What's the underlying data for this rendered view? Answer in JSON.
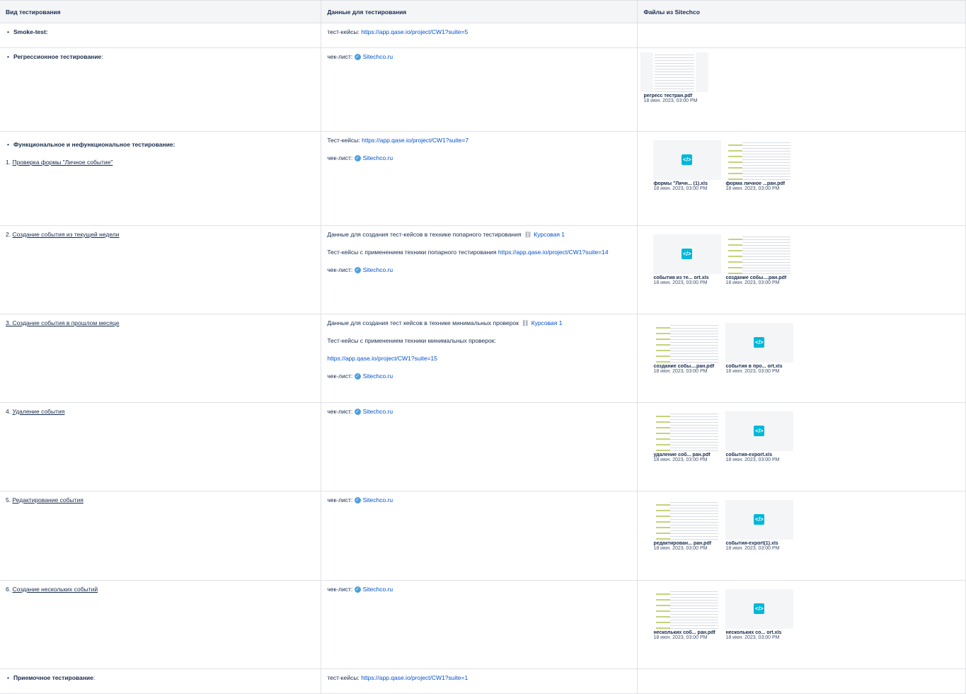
{
  "headers": {
    "col1": "Вид тестирования",
    "col2": "Данные для тестирования",
    "col3": "Файлы из Sitechco"
  },
  "common": {
    "checklist_prefix": "чек-лист:",
    "sitechco": "Sitechco.ru",
    "date": "18 июн. 2023, 03:00 PM",
    "kursovaya": "Курсовая 1"
  },
  "smoke": {
    "label": "Smoke-test:",
    "prefix": "тест-кейсы:",
    "link": "https://app.qase.io/project/CW1?suite=5"
  },
  "regression": {
    "label": "Регрессионное тестирование",
    "label_suffix": ":",
    "file": "регресс тестран.pdf"
  },
  "functional": {
    "label": "Функциональное и нефункциональное тестирование:",
    "item1_num": "1.",
    "item1": "Проверка формы \"Личное событие\"",
    "tc_prefix": "Тест-кейсы:",
    "tc_link": "https://app.qase.io/project/CW1?suite=7",
    "file1": "формы \"Личн... (1).xls",
    "file2": "форма личное ...ран.pdf"
  },
  "week": {
    "num": "2.",
    "label": "Создание события из текущей недели",
    "data_text": "Данные для создания тест-кейсов в технике попарного тестирования",
    "tc_text": "Тест-кейсы с применением техники попарного тестирования",
    "tc_link": "https://app.qase.io/project/CW1?suite=14",
    "file1": "события из те... ort.xls",
    "file2": "создание собы....ран.pdf"
  },
  "month": {
    "num": "3.",
    "label": "Создание события в прошлом месяце",
    "data_text": "Данные для создания тест кейсов в технике минимальных проверок",
    "tc_text": "Тест-кейсы с применением техники минимальных проверок:",
    "tc_link": "https://app.qase.io/project/CW1?suite=15",
    "file1": "создание собы....ран.pdf",
    "file2": "события в про... ort.xls"
  },
  "delete": {
    "num": "4.",
    "label": "Удаление события",
    "file1": "удаление соб... ран.pdf",
    "file2": "события-export.xls"
  },
  "edit": {
    "num": "5.",
    "label": "Редактирование события",
    "file1": "редактирован... ран.pdf",
    "file2": "события-export(1).xls"
  },
  "many": {
    "num": "6.",
    "label": "Создание нескольких событий",
    "file1": "нескольких соб... ран.pdf",
    "file2": "нескольких со... ort.xls"
  },
  "acceptance": {
    "label": "Приемочное тестирование",
    "label_suffix": ":",
    "prefix": "тест-кейсы:",
    "link": "https://app.qase.io/project/CW1?suite=1"
  },
  "icons": {
    "check": "checkmark-badge-icon",
    "link": "link-icon",
    "file_code": "code-file-icon"
  },
  "colors": {
    "link": "#0052cc",
    "header_bg": "#f4f5f7",
    "border": "#dfe1e6",
    "file_icon": "#00b8d9"
  }
}
